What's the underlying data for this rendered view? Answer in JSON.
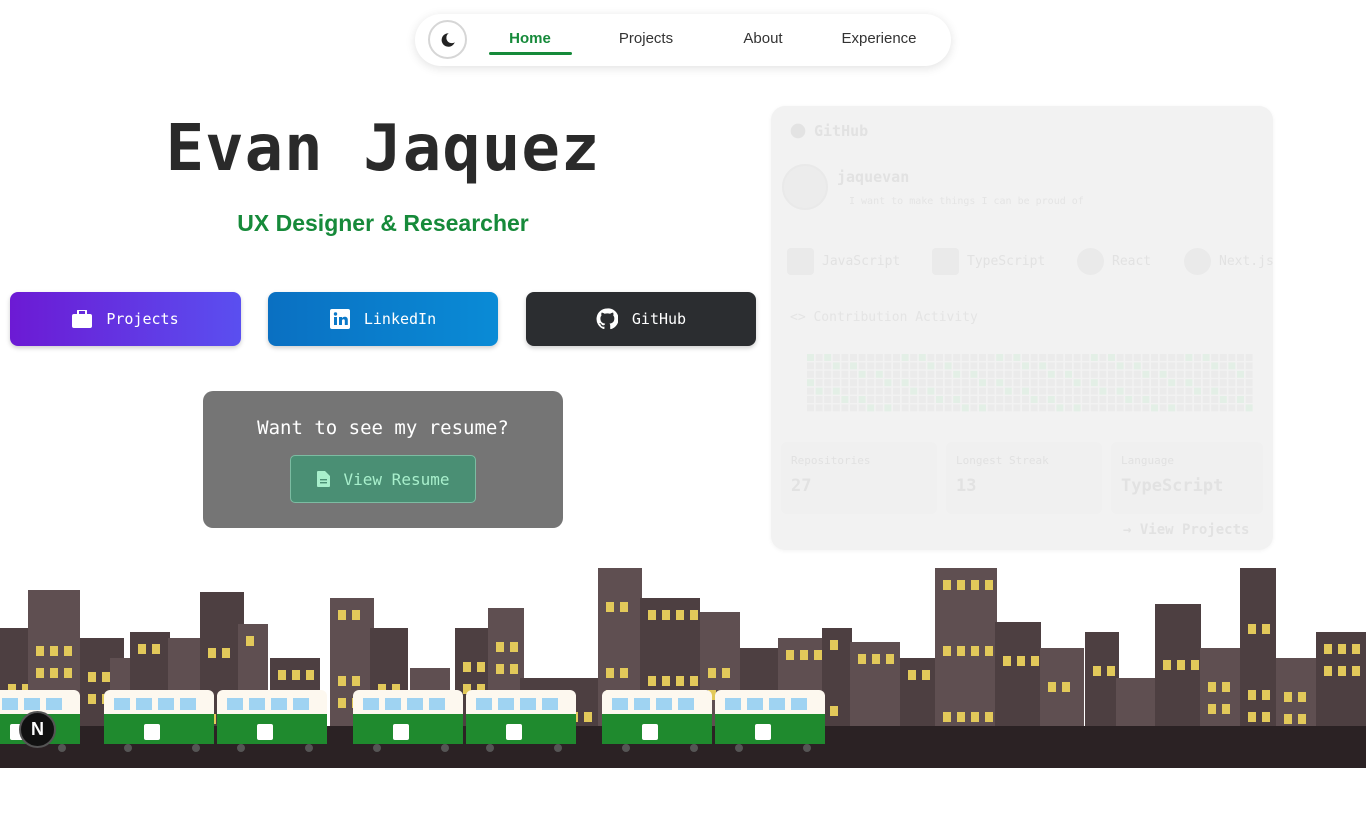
{
  "nav": {
    "items": [
      {
        "label": "Home",
        "active": true
      },
      {
        "label": "Projects",
        "active": false
      },
      {
        "label": "About",
        "active": false
      },
      {
        "label": "Experience",
        "active": false
      }
    ],
    "theme_icon": "moon-icon"
  },
  "hero": {
    "name": "Evan Jaquez",
    "subtitle": "UX Designer & Researcher"
  },
  "buttons": {
    "projects": "Projects",
    "linkedin": "LinkedIn",
    "github": "GitHub"
  },
  "resume": {
    "title": "Want to see my resume?",
    "button": "View Resume"
  },
  "github_card": {
    "header": "GitHub",
    "username": "jaquevan",
    "bio": "I want to make things I can be proud of",
    "tech": [
      "JavaScript",
      "TypeScript",
      "React",
      "Next.js"
    ],
    "contrib_label": "<> Contribution Activity",
    "stats": [
      {
        "label": "Repositories",
        "value": "27"
      },
      {
        "label": "Longest Streak",
        "value": "13"
      },
      {
        "label": "Language",
        "value": "TypeScript"
      }
    ],
    "view_link": "→ View Projects"
  },
  "badge": {
    "letter": "N"
  },
  "colors": {
    "accent_green": "#168a3a",
    "projects_purple": "#6c1ad4",
    "linkedin_blue": "#0a70c2",
    "github_dark": "#2b2d30",
    "building": "#5a4a4c",
    "window": "#e2c95a",
    "train_green": "#1f8a2e"
  }
}
